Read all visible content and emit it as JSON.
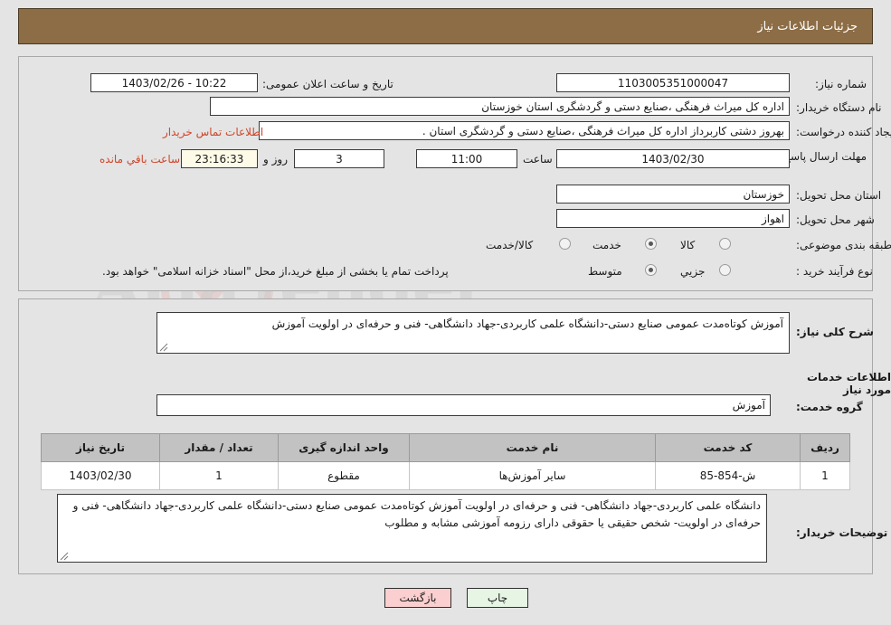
{
  "header": {
    "title": "جزئیات اطلاعات نیاز"
  },
  "colors": {
    "header_bg": "#8c6d46",
    "page_bg": "#e4e4e4",
    "link": "#d1452a",
    "cream_field": "#fdfbe7",
    "print_btn": "#e6f5e4",
    "back_btn": "#fbcfcf",
    "table_header": "#c2c2c2"
  },
  "form": {
    "need_number_label": "شماره نیاز:",
    "need_number_value": "1103005351000047",
    "announce_datetime_label": "تاریخ و ساعت اعلان عمومی:",
    "announce_datetime_value": "1403/02/26 - 10:22",
    "buyer_org_label": "نام دستگاه خریدار:",
    "buyer_org_value": "اداره کل میراث فرهنگی ،صنایع دستی و گردشگری استان خوزستان",
    "requester_label": "ایجاد کننده درخواست:",
    "requester_value": "بهروز دشتی کاربرداز اداره کل میراث فرهنگی ،صنایع دستی و گردشگری استان .",
    "buyer_contact_link": "اطلاعات تماس خریدار",
    "deadline_label": "مهلت ارسال پاسخ: تا تاریخ:",
    "deadline_date": "1403/02/30",
    "deadline_time_label": "ساعت",
    "deadline_time": "11:00",
    "days_remaining": "3",
    "days_label": "روز و",
    "countdown": "23:16:33",
    "remaining_suffix": "ساعت باقي مانده",
    "province_label": "استان محل تحویل:",
    "province_value": "خوزستان",
    "city_label": "شهر محل تحویل:",
    "city_value": "اهواز",
    "category_label": "طبقه بندی موضوعی:",
    "category_options": [
      "کالا",
      "خدمت",
      "کالا/خدمت"
    ],
    "category_selected": "خدمت",
    "process_label": "نوع فرآیند خرید :",
    "process_options": [
      "جزیي",
      "متوسط"
    ],
    "process_selected": "متوسط",
    "payment_note": "پرداخت تمام یا بخشی از مبلغ خرید،از محل \"اسناد خزانه اسلامی\" خواهد بود."
  },
  "main": {
    "general_desc_label": "شرح کلی نیاز:",
    "general_desc_value": "آموزش کوتاه‌مدت عمومی صنایع دستی-دانشگاه علمی کاربردی-جهاد دانشگاهی- فنی و حرفه‌ای در اولویت آموزش",
    "services_section_title": "اطلاعات خدمات مورد نیاز",
    "service_group_label": "گروه خدمت:",
    "service_group_value": "آموزش",
    "buyer_notes_label": "توضیحات خریدار:",
    "buyer_notes_value": "دانشگاه علمی کاربردی-جهاد دانشگاهی- فنی و حرفه‌ای در اولویت آموزش کوتاه‌مدت عمومی صنایع دستی-دانشگاه علمی کاربردی-جهاد دانشگاهی- فنی و حرفه‌ای در اولویت- شخص حقیقی یا حقوقی دارای رزومه آموزشی مشابه و مطلوب"
  },
  "table": {
    "columns": [
      "ردیف",
      "کد خدمت",
      "نام خدمت",
      "واحد اندازه گیری",
      "تعداد / مقدار",
      "تاریخ نیاز"
    ],
    "rows": [
      {
        "row_no": "1",
        "service_code": "ش-854-85",
        "service_name": "سایر آموزش‌ها",
        "unit": "مقطوع",
        "quantity": "1",
        "need_date": "1403/02/30"
      }
    ]
  },
  "footer": {
    "print_label": "چاپ",
    "back_label": "بازگشت"
  }
}
